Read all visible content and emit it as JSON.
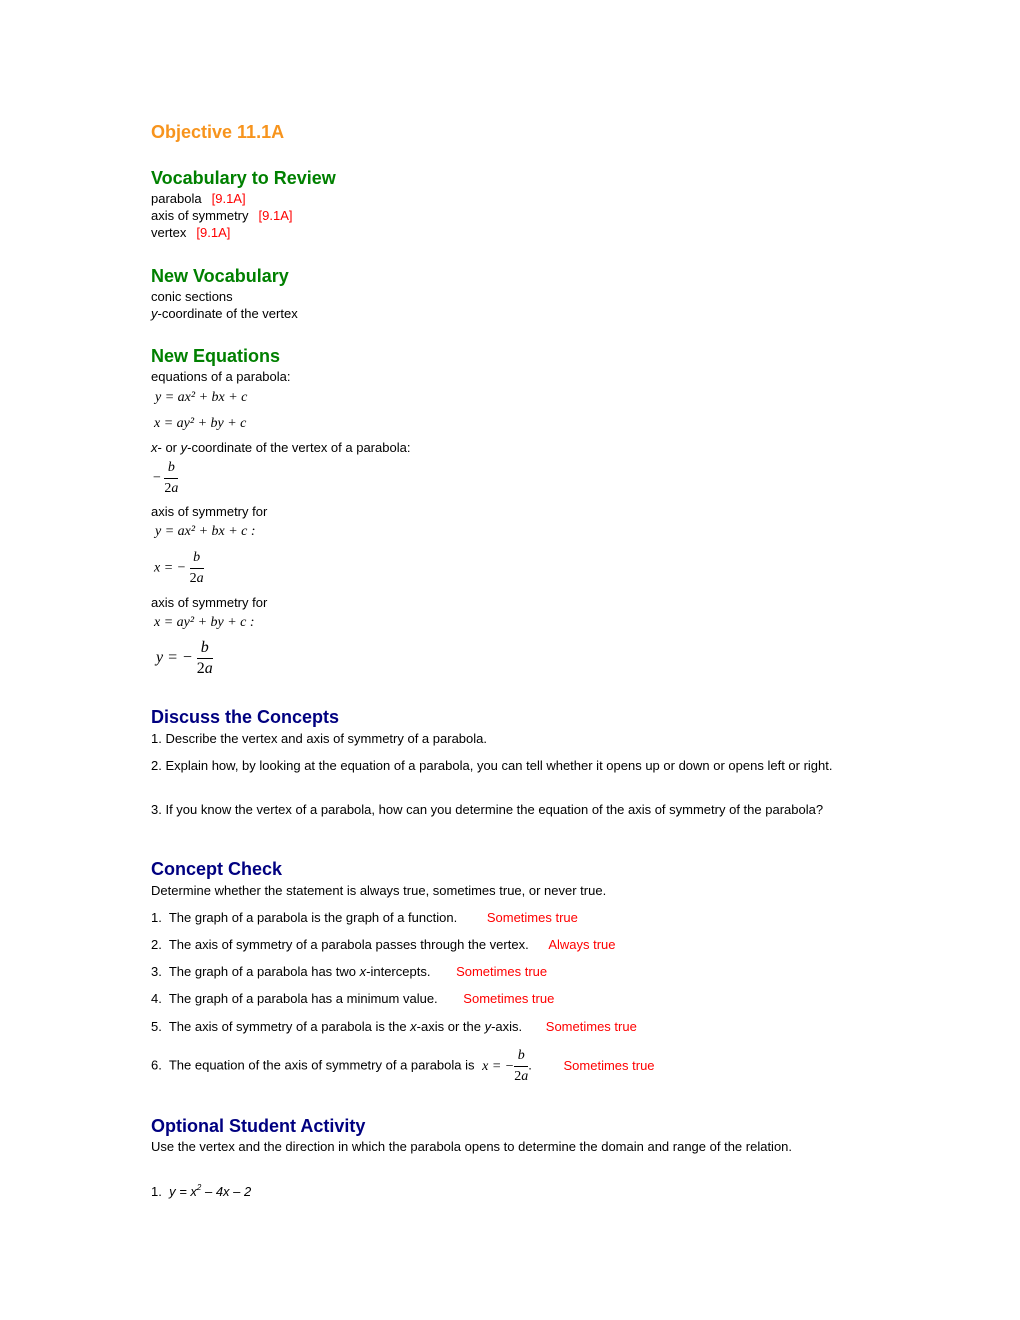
{
  "objective": "Objective 11.1A",
  "vocab_review": {
    "heading": "Vocabulary to Review",
    "items": [
      {
        "term": "parabola",
        "ref": "[9.1A]"
      },
      {
        "term": "axis of symmetry",
        "ref": "[9.1A]"
      },
      {
        "term": "vertex",
        "ref": "[9.1A]"
      }
    ]
  },
  "new_vocab": {
    "heading": "New Vocabulary",
    "items": [
      "conic sections",
      "-coordinate of the vertex"
    ],
    "italic_prefix": "y"
  },
  "new_equations": {
    "heading": "New Equations",
    "label1": "equations of a parabola:",
    "eq1": "y = ax² + bx + c",
    "eq2": "x = ay² + by + c",
    "label2_a": "x",
    "label2_b": "- or ",
    "label2_c": "y",
    "label2_d": "-coordinate of the vertex of a parabola:",
    "frac_num": "b",
    "frac_den_num": "2",
    "frac_den_var": "a",
    "label3": "axis of symmetry for",
    "eq3": "y = ax² + bx + c :",
    "eq4_lhs": "x = −",
    "label4": "axis of symmetry for",
    "eq5": "x = ay² + by + c :",
    "eq6_lhs": "y = −"
  },
  "discuss": {
    "heading": "Discuss the Concepts",
    "items": [
      "1.  Describe the vertex and axis of symmetry of a parabola.",
      "2.  Explain how, by looking at the equation of a parabola, you can tell whether it opens up or down or opens left or right.",
      "3.  If you know the vertex of a parabola, how can you determine the equation of the axis of symmetry of the parabola?"
    ]
  },
  "concept_check": {
    "heading": "Concept Check",
    "intro": "Determine whether the statement is always true, sometimes true, or never true.",
    "items": [
      {
        "num": "1.",
        "text": "The graph of a parabola is the graph of a function.",
        "answer": "Sometimes true"
      },
      {
        "num": "2.",
        "text": "The axis of symmetry of a parabola passes through the vertex.",
        "answer": "Always true"
      },
      {
        "num": "3.",
        "text_a": "The graph of a parabola has two ",
        "var": "x",
        "text_b": "-intercepts.",
        "answer": "Sometimes true"
      },
      {
        "num": "4.",
        "text": "The graph of a parabola has a minimum value.",
        "answer": "Sometimes true"
      },
      {
        "num": "5.",
        "text_a": "The axis of symmetry of a parabola is the ",
        "var1": "x",
        "text_b": "-axis or the ",
        "var2": "y",
        "text_c": "-axis.",
        "answer": "Sometimes true"
      },
      {
        "num": "6.",
        "text": "The equation of the axis of symmetry of a parabola is",
        "math_lhs": "x = −",
        "tail": ".",
        "answer": "Sometimes true"
      }
    ]
  },
  "activity": {
    "heading": "Optional Student Activity",
    "intro": "Use the vertex and the direction in which the parabola opens to determine the domain and range of the relation.",
    "item1_num": "1.",
    "item1_eq": "y = x² – 4x – 2"
  }
}
